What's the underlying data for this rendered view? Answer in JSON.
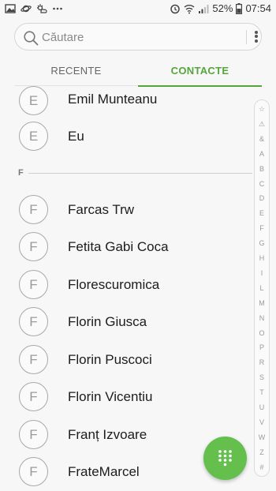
{
  "status_bar": {
    "battery_percent": "52%",
    "time": "07:54",
    "left_icons": [
      "gallery-icon",
      "planet-icon",
      "weather-icon",
      "more-notifications-icon"
    ],
    "right_icons": [
      "alarm-icon",
      "wifi-icon",
      "signal-icon",
      "battery-icon"
    ]
  },
  "search": {
    "placeholder": "Căutare"
  },
  "tabs": [
    {
      "label": "RECENTE",
      "active": false
    },
    {
      "label": "CONTACTE",
      "active": true
    }
  ],
  "colors": {
    "accent": "#54a63a",
    "fab": "#64bf4d"
  },
  "contacts_e": [
    {
      "initial": "E",
      "name": "Emil Munteanu"
    },
    {
      "initial": "E",
      "name": "Eu"
    }
  ],
  "section_f": {
    "letter": "F"
  },
  "contacts_f": [
    {
      "initial": "F",
      "name": "Farcas Trw"
    },
    {
      "initial": "F",
      "name": "Fetita Gabi Coca"
    },
    {
      "initial": "F",
      "name": "Florescuromica"
    },
    {
      "initial": "F",
      "name": "Florin Giusca"
    },
    {
      "initial": "F",
      "name": "Florin Puscoci"
    },
    {
      "initial": "F",
      "name": "Florin Vicentiu"
    },
    {
      "initial": "F",
      "name": "Franț Izvoare"
    },
    {
      "initial": "F",
      "name": "FrateMarcel"
    }
  ],
  "index_bar": [
    "☆",
    "⚠",
    "&",
    "A",
    "B",
    "C",
    "D",
    "E",
    "F",
    "G",
    "H",
    "I",
    "L",
    "M",
    "N",
    "O",
    "P",
    "R",
    "S",
    "T",
    "U",
    "V",
    "W",
    "Z",
    "#"
  ],
  "fab": {
    "icon": "dialpad-icon"
  }
}
